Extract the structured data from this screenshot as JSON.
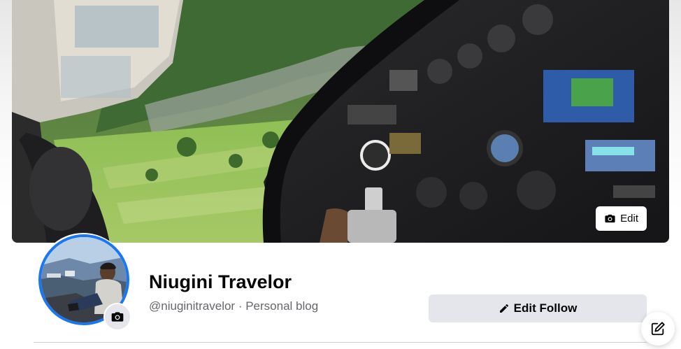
{
  "cover": {
    "edit_label": "Edit",
    "camera_icon": "camera-icon"
  },
  "profile": {
    "name": "Niugini Travelor",
    "meta": "@niuginitravelor · Personal blog",
    "avatar_camera_icon": "camera-icon"
  },
  "actions": {
    "edit_follow_label": "Edit Follow",
    "edit_follow_icon": "pencil-icon"
  },
  "floating": {
    "compose_icon": "compose-icon"
  },
  "colors": {
    "accent": "#1877f2",
    "button_bg": "#e4e6eb",
    "text_primary": "#050505",
    "text_secondary": "#65676b"
  }
}
